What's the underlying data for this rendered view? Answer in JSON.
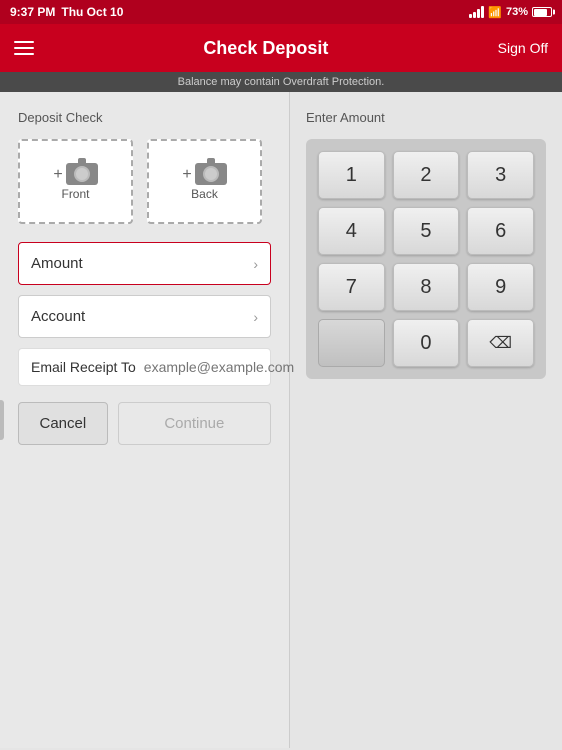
{
  "statusBar": {
    "time": "9:37 PM",
    "date": "Thu Oct 10",
    "wifi": true,
    "signalLabel": "signal",
    "batteryPercent": "73%"
  },
  "header": {
    "title": "Check Deposit",
    "menuIcon": "hamburger-icon",
    "signOffLabel": "Sign Off"
  },
  "noticeBanner": "Balance may contain Overdraft Protection.",
  "leftPanel": {
    "sectionTitle": "Deposit Check",
    "front": {
      "label": "Front",
      "buttonIcon": "camera-icon"
    },
    "back": {
      "label": "Back",
      "buttonIcon": "camera-icon"
    },
    "amountField": {
      "label": "Amount",
      "placeholder": ""
    },
    "accountField": {
      "label": "Account",
      "placeholder": ""
    },
    "emailField": {
      "label": "Email Receipt To",
      "placeholder": "example@example.com"
    },
    "cancelButton": "Cancel",
    "continueButton": "Continue"
  },
  "rightPanel": {
    "sectionTitle": "Enter Amount",
    "numpad": {
      "keys": [
        "1",
        "2",
        "3",
        "4",
        "5",
        "6",
        "7",
        "8",
        "9",
        "",
        "0",
        "⌫"
      ]
    }
  }
}
